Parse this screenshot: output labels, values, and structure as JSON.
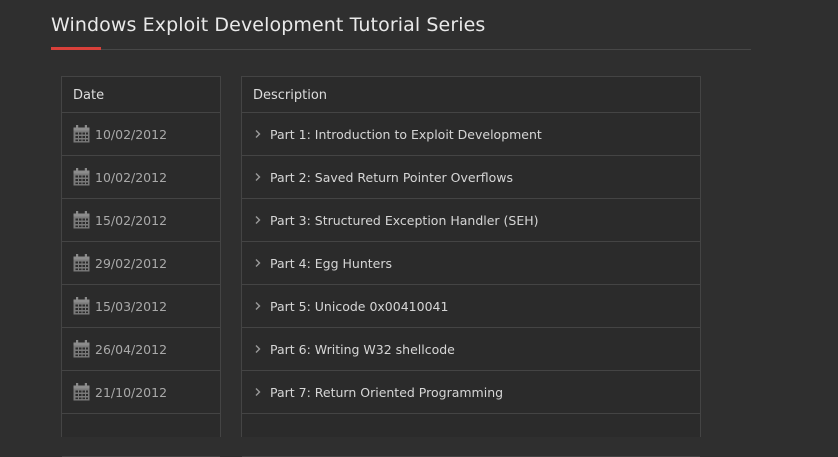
{
  "page": {
    "title": "Windows Exploit Development Tutorial Series"
  },
  "table": {
    "date_header": "Date",
    "description_header": "Description",
    "rows": [
      {
        "date": "10/02/2012",
        "description": "Part 1: Introduction to Exploit Development"
      },
      {
        "date": "10/02/2012",
        "description": "Part 2: Saved Return Pointer Overflows"
      },
      {
        "date": "15/02/2012",
        "description": "Part 3: Structured Exception Handler (SEH)"
      },
      {
        "date": "29/02/2012",
        "description": "Part 4: Egg Hunters"
      },
      {
        "date": "15/03/2012",
        "description": "Part 5: Unicode 0x00410041"
      },
      {
        "date": "26/04/2012",
        "description": "Part 6: Writing W32 shellcode"
      },
      {
        "date": "21/10/2012",
        "description": "Part 7: Return Oriented Programming"
      }
    ]
  },
  "icons": {
    "date": "calendar-icon",
    "description": "chevron-right-icon"
  },
  "colors": {
    "background": "#2f2f2f",
    "accent": "#d9403a",
    "border": "#444444"
  }
}
